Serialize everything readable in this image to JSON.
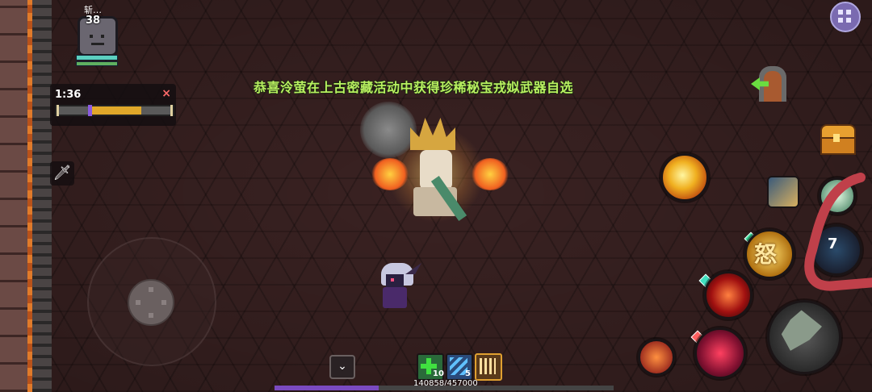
{
  "player": {
    "name": "斩…",
    "level": "38"
  },
  "timer": {
    "time": "1:36",
    "close_symbol": "×",
    "progress": 0.73,
    "marker": 0.27
  },
  "announcement": "恭喜泠萤在上古密藏活动中获得珍稀秘宝戎姒武器自选",
  "skills": {
    "anger_label": "怒",
    "cooldown_value": "7"
  },
  "inventory": {
    "expand_symbol": "⌄",
    "slots": [
      {
        "icon": "green-cross-icon",
        "count": "10"
      },
      {
        "icon": "blue-wave-icon",
        "count": "5"
      },
      {
        "icon": "claw-icon",
        "count": ""
      }
    ]
  },
  "experience": {
    "text": "140858/457000",
    "current": 140858,
    "max": 457000
  },
  "icons": {
    "menu": "menu-grid-icon",
    "exit": "exit-door-icon",
    "chest": "treasure-chest-icon",
    "sword_quick": "sword-icon"
  },
  "colors": {
    "announcement": "#b8f060",
    "xp_fill": "#7a4ac0",
    "timer_fill": "#e0a82a",
    "annotation": "#c0404a"
  }
}
